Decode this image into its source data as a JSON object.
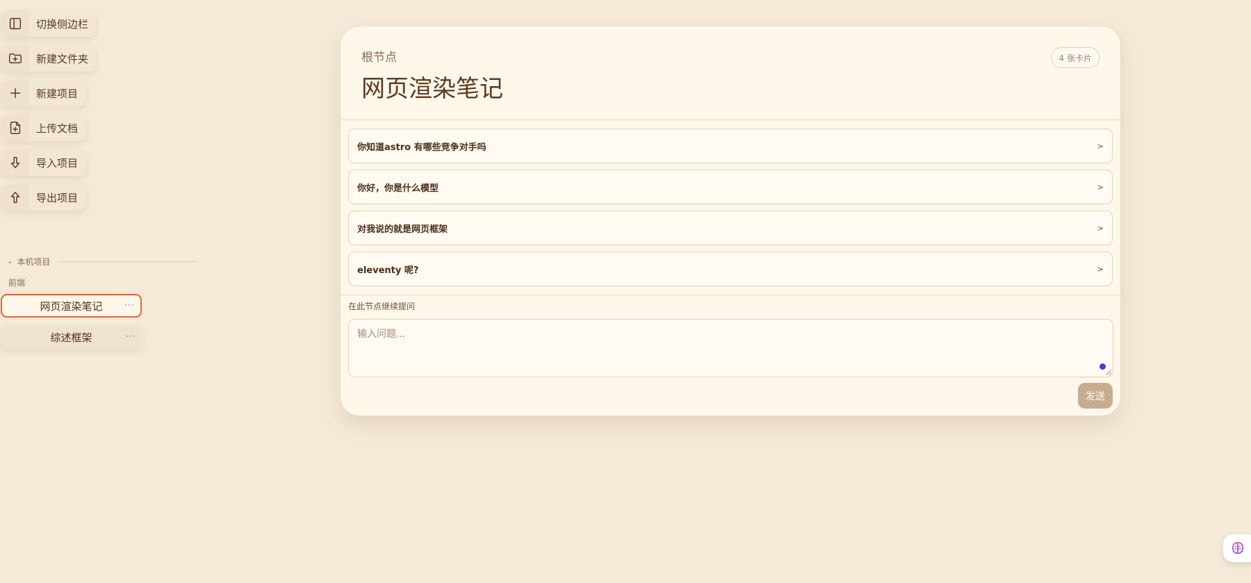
{
  "toolbar": {
    "items": [
      {
        "icon": "sidebar-toggle-icon",
        "label": "切换侧边栏"
      },
      {
        "icon": "folder-plus-icon",
        "label": "新建文件夹"
      },
      {
        "icon": "plus-icon",
        "label": "新建项目"
      },
      {
        "icon": "file-plus-icon",
        "label": "上传文档"
      },
      {
        "icon": "arrow-down-icon",
        "label": "导入项目"
      },
      {
        "icon": "arrow-up-icon",
        "label": "导出项目"
      }
    ]
  },
  "sidebar": {
    "section_label": "本机项目",
    "group_label": "前端",
    "projects": [
      {
        "label": "网页渲染笔记",
        "active": true
      },
      {
        "label": "综述框架",
        "active": false
      }
    ],
    "more_glyph": "···"
  },
  "card": {
    "breadcrumb": "根节点",
    "title": "网页渲染笔记",
    "count_badge": "4 张卡片",
    "rows": [
      {
        "label": "你知道astro 有哪些竞争对手吗",
        "arrow": ">"
      },
      {
        "label": "你好，你是什么模型",
        "arrow": ">"
      },
      {
        "label": "对我说的就是网页框架",
        "arrow": ">"
      },
      {
        "label": "eleventy 呢?",
        "arrow": ">"
      }
    ],
    "ask_label": "在此节点继续提问",
    "ask_placeholder": "输入问题...",
    "send_label": "发送"
  },
  "colors": {
    "background": "#f5ead8",
    "card": "#fff7ea",
    "accent_border": "#e0673a",
    "send_button": "#c8ac91",
    "indicator_dot": "#4f35e2"
  },
  "fab": {
    "icon": "brain-icon"
  }
}
